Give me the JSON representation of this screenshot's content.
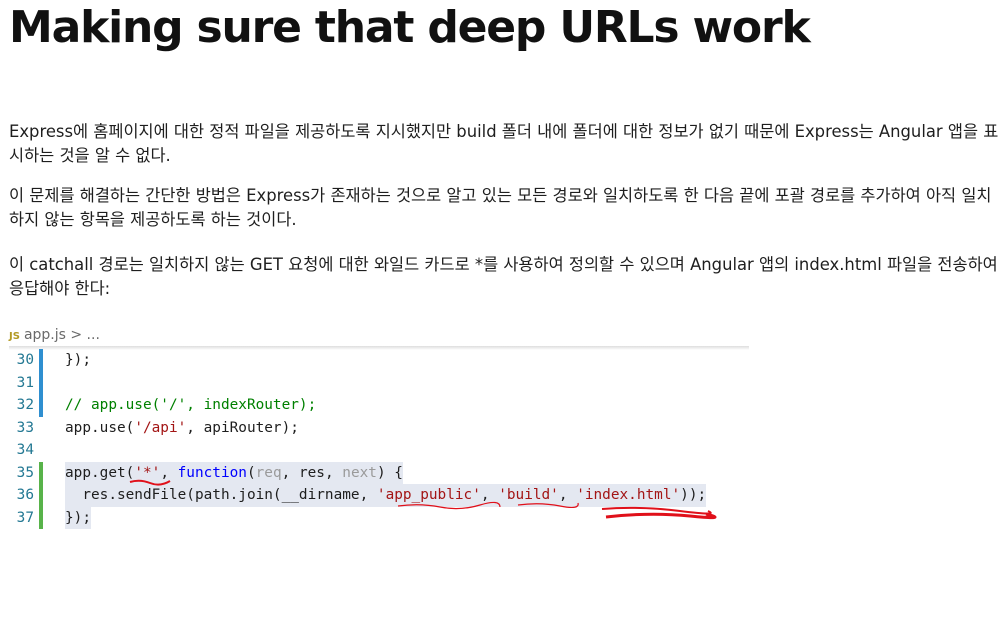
{
  "heading": "Making sure that deep URLs work",
  "paragraphs": [
    "Express에 홈페이지에 대한 정적 파일을 제공하도록 지시했지만 build 폴더 내에 폴더에 대한 정보가 없기 때문에 Express는 Angular 앱을 표시하는 것을 알 수 없다.",
    "이 문제를 해결하는 간단한 방법은 Express가 존재하는 것으로 알고 있는 모든 경로와 일치하도록 한 다음 끝에 포괄 경로를 추가하여 아직 일치하지 않는 항목을 제공하도록 하는 것이다.",
    "이 catchall 경로는 일치하지 않는 GET 요청에 대한 와일드 카드로 *를 사용하여 정의할 수 있으며 Angular 앱의 index.html 파일을 전송하여 응답해야 한다:"
  ],
  "editor": {
    "breadcrumb_icon": "JS",
    "breadcrumb": "app.js > ...",
    "lines": [
      {
        "num": "30",
        "text": "});"
      },
      {
        "num": "31",
        "text": ""
      },
      {
        "num": "32",
        "text": "// app.use('/', indexRouter);"
      },
      {
        "num": "33",
        "text": "app.use('/api', apiRouter);"
      },
      {
        "num": "34",
        "text": ""
      },
      {
        "num": "35",
        "text": "app.get('*', function(req, res, next) {"
      },
      {
        "num": "36",
        "text": "  res.sendFile(path.join(__dirname, 'app_public', 'build', 'index.html'));"
      },
      {
        "num": "37",
        "text": "});"
      }
    ],
    "tokens": {
      "l30_a": "});",
      "l32_a": "// app.use('/', indexRouter);",
      "l33_a": "app.use(",
      "l33_b": "'/api'",
      "l33_c": ", apiRouter);",
      "l35_a": "app.get(",
      "l35_b": "'*'",
      "l35_c": ", ",
      "l35_d": "function",
      "l35_e": "(",
      "l35_f": "req",
      "l35_g": ", ",
      "l35_h": "res",
      "l35_i": ", ",
      "l35_j": "next",
      "l35_k": ") {",
      "l36_a": "  res.sendFile(path.join(__dirname, ",
      "l36_b": "'app_public'",
      "l36_c": ", ",
      "l36_d": "'build'",
      "l36_e": ", ",
      "l36_f": "'index.html'",
      "l36_g": "));",
      "l37_a": "});"
    },
    "colors": {
      "string": "#a31515",
      "comment": "#008000",
      "keyword": "#0000ff",
      "line_number": "#237893",
      "selection": "#e4e8f1",
      "modified_marker": "#2f8fd0",
      "added_marker": "#58b34a",
      "annotation": "#e0101a"
    }
  }
}
